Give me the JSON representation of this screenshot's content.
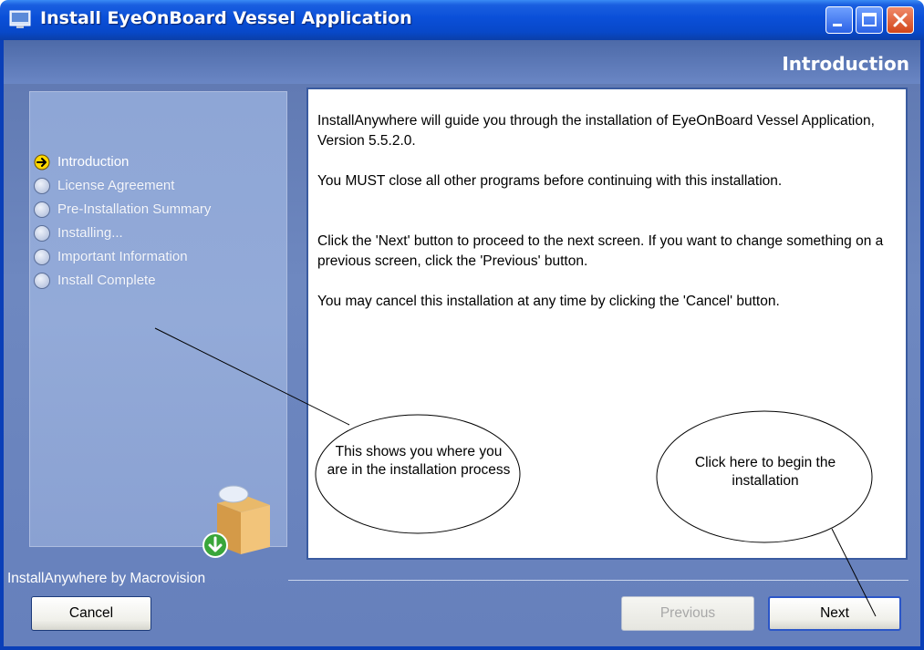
{
  "window": {
    "title": "Install EyeOnBoard Vessel Application",
    "page_title": "Introduction"
  },
  "steps": [
    {
      "label": "Introduction",
      "state": "current"
    },
    {
      "label": "License Agreement",
      "state": "pending"
    },
    {
      "label": "Pre-Installation Summary",
      "state": "pending"
    },
    {
      "label": "Installing...",
      "state": "pending"
    },
    {
      "label": "Important Information",
      "state": "pending"
    },
    {
      "label": "Install Complete",
      "state": "pending"
    }
  ],
  "content": {
    "paragraphs": [
      "InstallAnywhere will guide you through the installation of EyeOnBoard Vessel Application, Version 5.5.2.0.",
      "You MUST close all other programs before continuing with this installation.",
      "Click the 'Next' button to proceed to the next screen. If you want to change something on a previous screen, click the 'Previous' button.",
      "You may cancel this installation at any time by clicking the 'Cancel' button."
    ]
  },
  "footer": {
    "vendor": "InstallAnywhere by Macrovision",
    "cancel_label": "Cancel",
    "previous_label": "Previous",
    "next_label": "Next"
  },
  "callouts": {
    "left": "This shows you where you are in the installation process",
    "right": "Click here to begin the installation"
  },
  "colors": {
    "titlebar": "#0a4fd8",
    "body_bg": "#6e88c0",
    "current_step_marker": "#ffd800"
  },
  "icons": {
    "app": "installer-icon",
    "minimize": "minimize-icon",
    "maximize": "maximize-icon",
    "close": "close-icon",
    "current_step": "arrow-right-circle-icon",
    "pending_step": "empty-circle-icon",
    "box_art": "software-box-icon"
  }
}
